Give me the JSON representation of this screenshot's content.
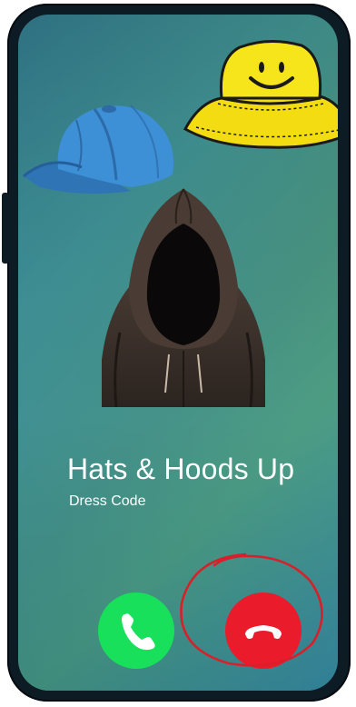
{
  "call": {
    "caller_name": "Hats & Hoods Up",
    "caller_subtitle": "Dress Code"
  },
  "buttons": {
    "accept_icon": "phone-icon",
    "decline_icon": "hang-up-icon"
  },
  "art": [
    "baseball-cap-icon",
    "smiley-bucket-hat-icon",
    "hooded-figure-avatar"
  ],
  "colors": {
    "accept": "#18e05a",
    "decline": "#ea1b2b",
    "annotation": "#d8202a",
    "frame": "#0d1b24"
  }
}
